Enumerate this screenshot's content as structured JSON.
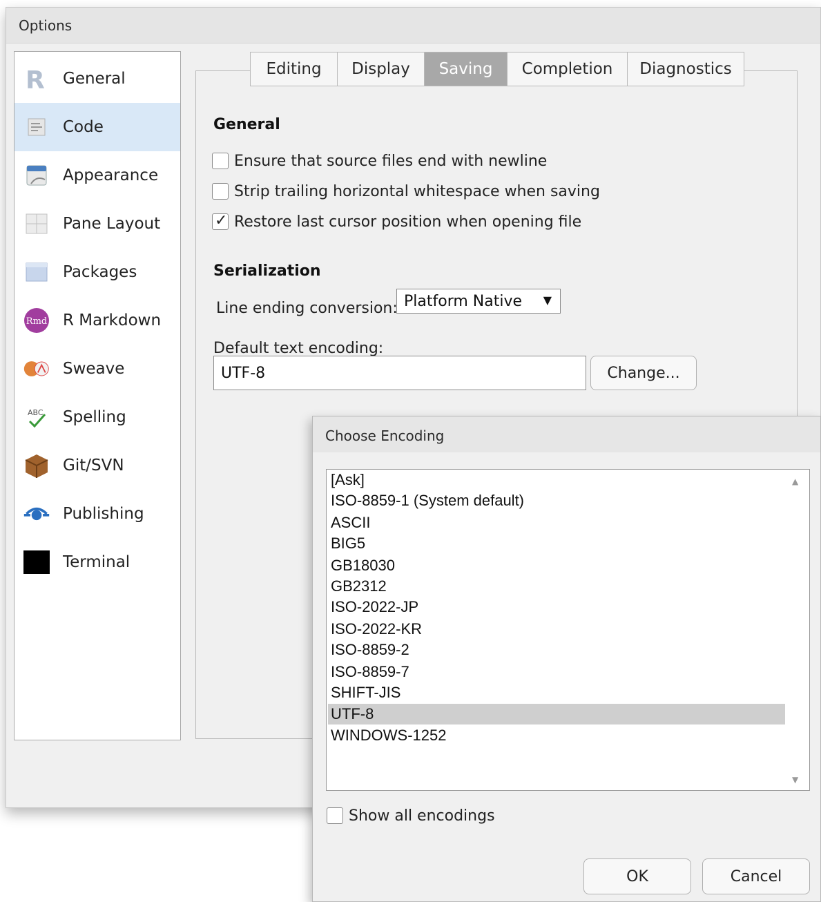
{
  "window": {
    "title": "Options"
  },
  "sidebar": {
    "items": [
      {
        "label": "General",
        "icon": "r-logo-icon"
      },
      {
        "label": "Code",
        "icon": "code-icon",
        "selected": true
      },
      {
        "label": "Appearance",
        "icon": "appearance-icon"
      },
      {
        "label": "Pane Layout",
        "icon": "pane-layout-icon"
      },
      {
        "label": "Packages",
        "icon": "packages-icon"
      },
      {
        "label": "R Markdown",
        "icon": "rmarkdown-icon"
      },
      {
        "label": "Sweave",
        "icon": "sweave-icon"
      },
      {
        "label": "Spelling",
        "icon": "spelling-icon"
      },
      {
        "label": "Git/SVN",
        "icon": "git-icon"
      },
      {
        "label": "Publishing",
        "icon": "publishing-icon"
      },
      {
        "label": "Terminal",
        "icon": "terminal-icon"
      }
    ]
  },
  "tabs": [
    {
      "label": "Editing"
    },
    {
      "label": "Display"
    },
    {
      "label": "Saving",
      "active": true
    },
    {
      "label": "Completion"
    },
    {
      "label": "Diagnostics"
    }
  ],
  "general": {
    "header": "General",
    "options": [
      {
        "label": "Ensure that source files end with newline",
        "checked": false
      },
      {
        "label": "Strip trailing horizontal whitespace when saving",
        "checked": false
      },
      {
        "label": "Restore last cursor position when opening file",
        "checked": true
      }
    ]
  },
  "serialization": {
    "header": "Serialization",
    "line_ending_label": "Line ending conversion:",
    "line_ending_value": "Platform Native",
    "encoding_label": "Default text encoding:",
    "encoding_value": "UTF-8",
    "change_button": "Change..."
  },
  "encoding_dialog": {
    "title": "Choose Encoding",
    "items": [
      "[Ask]",
      "ISO-8859-1 (System default)",
      "ASCII",
      "BIG5",
      "GB18030",
      "GB2312",
      "ISO-2022-JP",
      "ISO-2022-KR",
      "ISO-8859-2",
      "ISO-8859-7",
      "SHIFT-JIS",
      "UTF-8",
      "WINDOWS-1252"
    ],
    "selected": "UTF-8",
    "show_all_label": "Show all encodings",
    "show_all_checked": false,
    "ok_label": "OK",
    "cancel_label": "Cancel"
  },
  "colors": {
    "selected_sidebar": "#d9e8f7",
    "active_tab": "#a8a8a8",
    "selected_list_item": "#cfcfcf"
  }
}
